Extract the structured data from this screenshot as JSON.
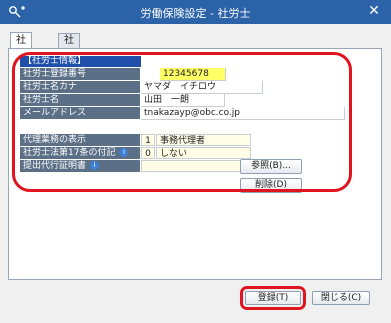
{
  "window": {
    "title": "労働保険設定 - 社労士",
    "close_glyph": "✕"
  },
  "tabs": [
    {
      "label": "社労士"
    },
    {
      "label": "社労士事務所"
    }
  ],
  "section": {
    "header": "【社労士情報】"
  },
  "fields": {
    "registration_number": {
      "label": "社労士登録番号",
      "value": "12345678"
    },
    "name_kana": {
      "label": "社労士名カナ",
      "value": "ヤマダ　イチロウ"
    },
    "name": {
      "label": "社労士名",
      "value": "山田　一朗"
    },
    "email": {
      "label": "メールアドレス",
      "value": "tnakazayp@obc.co.jp"
    },
    "agency_display": {
      "label": "代理業務の表示",
      "code": "1",
      "text": "事務代理者"
    },
    "article17": {
      "label": "社労士法第17条の付記",
      "code": "0",
      "text": "しない"
    },
    "proof": {
      "label": "提出代行証明書"
    }
  },
  "buttons": {
    "browse": "参照(B)...",
    "delete": "削除(D)",
    "register": "登録(T)",
    "close": "閉じる(C)"
  },
  "icons": {
    "info": "i"
  },
  "colors": {
    "titlebar": "#2b62a8",
    "highlight": "#e0141e",
    "label_bg": "#5b6f86",
    "section_bg": "#1f4fa8",
    "registration_bg": "#ffff66"
  }
}
